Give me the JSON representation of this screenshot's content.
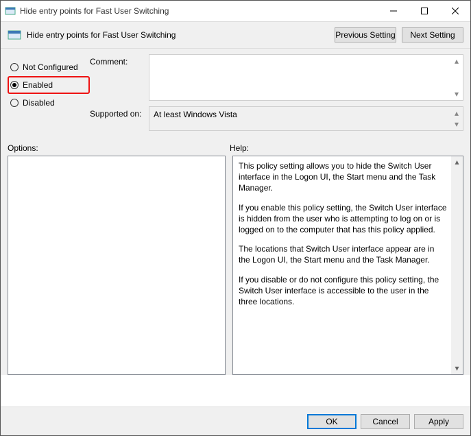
{
  "window": {
    "title": "Hide entry points for Fast User Switching"
  },
  "header": {
    "title": "Hide entry points for Fast User Switching",
    "prev_btn": "Previous Setting",
    "next_btn": "Next Setting"
  },
  "state": {
    "not_configured": "Not Configured",
    "enabled": "Enabled",
    "disabled": "Disabled",
    "selected": "enabled"
  },
  "fields": {
    "comment_label": "Comment:",
    "comment_value": "",
    "supported_label": "Supported on:",
    "supported_value": "At least Windows Vista"
  },
  "sections": {
    "options_label": "Options:",
    "help_label": "Help:"
  },
  "help": {
    "p1": "This policy setting allows you to hide the Switch User interface in the Logon UI, the Start menu and the Task Manager.",
    "p2": "If you enable this policy setting, the Switch User interface is hidden from the user who is attempting to log on or is logged on to the computer that has this policy applied.",
    "p3": "The locations that Switch User interface appear are in the Logon UI, the Start menu and the Task Manager.",
    "p4": "If you disable or do not configure this policy setting, the Switch User interface is accessible to the user in the three locations."
  },
  "footer": {
    "ok": "OK",
    "cancel": "Cancel",
    "apply": "Apply"
  }
}
